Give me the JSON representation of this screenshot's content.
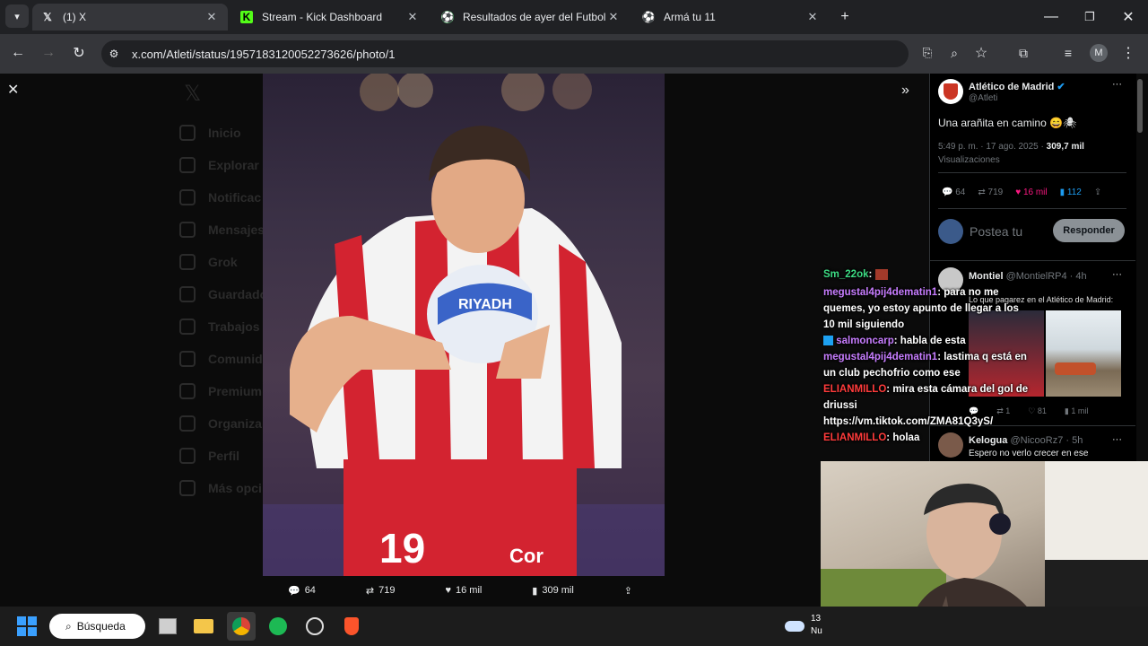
{
  "browser": {
    "tabs": [
      {
        "title": "(1) X",
        "icon": "x-logo-icon"
      },
      {
        "title": "Stream - Kick Dashboard",
        "icon": "kick-logo-icon"
      },
      {
        "title": "Resultados de ayer del Futbol A",
        "icon": "soccer-ball-icon"
      },
      {
        "title": "Armá tu 11",
        "icon": "soccer-ball-icon"
      }
    ],
    "url": "x.com/Atleti/status/1957183120052273626/photo/1",
    "profile_initial": "M"
  },
  "photo": {
    "jersey_number": "19",
    "sponsor_text": "RIYADH",
    "brand_text": "Cor"
  },
  "photo_actions": {
    "replies": "64",
    "reposts": "719",
    "likes": "16 mil",
    "views": "309 mil"
  },
  "tweet": {
    "author_name": "Atlético de Madrid",
    "handle": "@Atleti",
    "text": "Una arañita en camino 😄🕷",
    "time": "5:49 p. m. · 17 ago. 2025 ·",
    "views_count": "309,7 mil",
    "views_label": "Visualizaciones",
    "replies": "64",
    "reposts": "719",
    "likes": "16 mil",
    "bookmarks": "112",
    "reply_placeholder": "Postea tu",
    "reply_button": "Responder"
  },
  "replies": [
    {
      "name": "Montiel",
      "handle": "@MontielRP4 · 4h",
      "quote": "Lo que pagarez en el Atlético de Madrid:",
      "replies": "",
      "reposts": "1",
      "likes": "81",
      "views": "1 mil"
    },
    {
      "name": "Kelogua",
      "handle": "@NicooRz7 · 5h",
      "text": "Espero no verlo crecer en ese"
    }
  ],
  "chat": [
    {
      "user": "Sm_22ok",
      "color": "#3ddc84",
      "message": ""
    },
    {
      "user": "megustal4pij4dematin1",
      "color": "#c77dff",
      "message": "para no me quemes, yo estoy apunto de llegar a los 10 mil siguiendo"
    },
    {
      "user": "salmoncarp",
      "color": "#c77dff",
      "message": "habla de esta"
    },
    {
      "user": "megustal4pij4dematin1",
      "color": "#c77dff",
      "message": "lastima q está en un club pechofrio como ese"
    },
    {
      "user": "ELIANMILLO",
      "color": "#ff3b3b",
      "message": "mira esta cámara del gol de driussi https://vm.tiktok.com/ZMA81Q3yS/"
    },
    {
      "user": "ELIANMILLO",
      "color": "#ff3b3b",
      "message": "holaa"
    }
  ],
  "background_nav": [
    "Inicio",
    "Explorar",
    "Notificac",
    "Mensajes",
    "Grok",
    "Guardado",
    "Trabajos",
    "Comunid",
    "Premium",
    "Organiza",
    "Perfil",
    "Más opci"
  ],
  "taskbar": {
    "search_label": "Búsqueda",
    "clock": "13",
    "clock_sub": "Nu"
  },
  "colors": {
    "accent_blue": "#1d9bf0",
    "like_pink": "#f91880",
    "respond_btn": "#eff3f4"
  }
}
